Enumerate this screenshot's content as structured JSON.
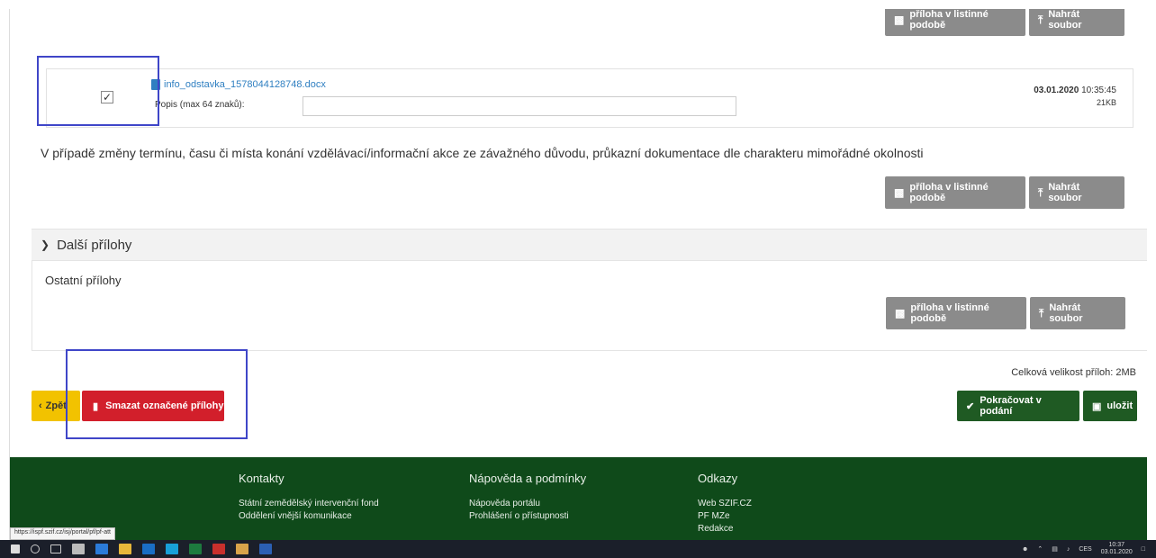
{
  "buttons": {
    "paper_attachment": "příloha v listinné podobě",
    "upload_file": "Nahrát soubor",
    "back": "Zpět",
    "delete_selected": "Smazat označené přílohy",
    "continue": "Pokračovat v podání",
    "save": "uložit"
  },
  "file_row": {
    "checked": true,
    "filename": "info_odstavka_1578044128748.docx",
    "description_label": "Popis (max 64 znaků):",
    "description_value": "",
    "date": "03.01.2020",
    "time": "10:35:45",
    "size": "21KB"
  },
  "sections": {
    "change_notice": "V případě změny termínu, času či místa konání vzdělávací/informační akce ze závažného důvodu, průkazní dokumentace dle charakteru mimořádné okolnosti",
    "other_attachments_header": "Další přílohy",
    "other_attachments_label": "Ostatní přílohy"
  },
  "total_size": "Celková velikost příloh: 2MB",
  "footer": {
    "contacts": {
      "title": "Kontakty",
      "items": [
        "Státní zemědělský intervenční fond",
        "Oddělení vnější komunikace"
      ]
    },
    "help": {
      "title": "Nápověda a podmínky",
      "items": [
        "Nápověda portálu",
        "Prohlášení o přístupnosti"
      ]
    },
    "links": {
      "title": "Odkazy",
      "items": [
        "Web SZIF.CZ",
        "PF MZe",
        "Redakce"
      ]
    }
  },
  "status_url": "https://ispf.szif.cz/isj/portal/pf/pf-att",
  "taskbar": {
    "language": "CES",
    "time": "10:37",
    "date": "03.01.2020"
  },
  "colors": {
    "button_gray": "#8b8b8b",
    "back_yellow": "#f2c200",
    "delete_red": "#d21f2b",
    "green": "#1f5a23",
    "footer_green": "#0f4a1a",
    "link_blue": "#2f7fc1",
    "highlight_blue": "#3f46c8"
  }
}
